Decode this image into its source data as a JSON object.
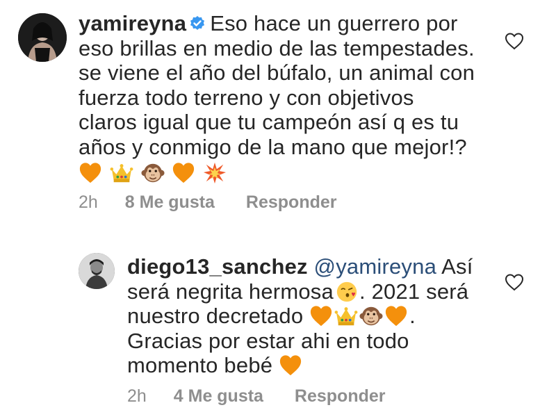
{
  "comments": [
    {
      "username": "yamireyna",
      "verified": true,
      "lines": [
        "Eso hace un guerrero por",
        "eso brillas en medio de las tempestades.",
        "se viene el año del búfalo, un animal con",
        "fuerza todo terreno y con objetivos",
        "claros igual que tu campeón así q es tu",
        "años y conmigo de la mano que mejor!?"
      ],
      "emojis": [
        "orange-heart",
        "crown",
        "monkey-face",
        "orange-heart",
        "collision"
      ],
      "time": "2h",
      "likes": "8 Me gusta",
      "reply": "Responder"
    },
    {
      "username": "diego13_sanchez",
      "mention": "@yamireyna",
      "lines": [
        "Así",
        "será negrita hermosa",
        ". 2021 será",
        "nuestro decretado",
        ".",
        "Gracias por estar ahi en todo",
        "momento bebé"
      ],
      "time": "2h",
      "likes": "4 Me gusta",
      "reply": "Responder"
    }
  ],
  "colors": {
    "text": "#262626",
    "meta": "#8e8e8e",
    "mention": "#2b4e78",
    "verified": "#3897f0",
    "orange_heart": "#f4900c"
  }
}
